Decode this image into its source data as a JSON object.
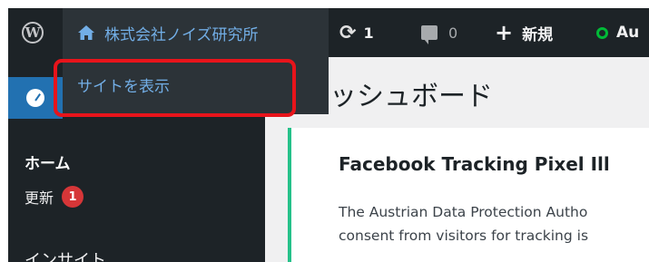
{
  "adminbar": {
    "site_name": "株式会社ノイズ研究所",
    "updates_count": "1",
    "comments_count": "0",
    "new_label": "新規",
    "plugin_label": "Au"
  },
  "submenu": {
    "view_site_label": "サイトを表示"
  },
  "sidebar": {
    "home_label": "ホーム",
    "update_label": "更新",
    "update_badge": "1",
    "insight_label": "インサイト"
  },
  "page": {
    "title": "ッシュボード"
  },
  "notice": {
    "title": "Facebook Tracking Pixel Ill",
    "lines": [
      "The Austrian Data Protection Autho",
      "consent from visitors for tracking is"
    ]
  },
  "colors": {
    "adminbar_bg": "#1d2327",
    "link_blue": "#72aee6",
    "active_blue": "#2271b1",
    "highlight_red": "#e8141b",
    "notice_green": "#25c189",
    "badge_red": "#d63638"
  },
  "icons": [
    "wordpress-logo-icon",
    "home-icon",
    "refresh-icon",
    "comment-icon",
    "plus-icon",
    "status-dot-icon",
    "dashboard-gauge-icon"
  ]
}
